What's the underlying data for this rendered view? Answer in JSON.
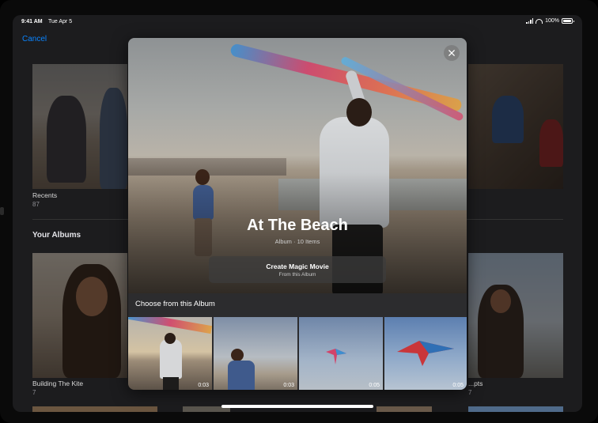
{
  "status_bar": {
    "time": "9:41 AM",
    "date": "Tue Apr 5",
    "battery": "100%"
  },
  "nav": {
    "cancel_label": "Cancel"
  },
  "recents": {
    "label": "Recents",
    "count": "87"
  },
  "your_albums": {
    "title": "Your Albums",
    "items": [
      {
        "label": "Building The Kite",
        "count": "7"
      },
      {
        "label": "...pts",
        "count": "7"
      }
    ]
  },
  "modal": {
    "album_title": "At The Beach",
    "album_subtitle": "Album · 10 Items",
    "magic_movie": {
      "title": "Create Magic Movie",
      "subtitle": "From this Album"
    },
    "choose_label": "Choose from this Album",
    "thumbnails": [
      {
        "duration": "0:03"
      },
      {
        "duration": "0:03"
      },
      {
        "duration": "0:05"
      },
      {
        "duration": "0:05"
      }
    ]
  },
  "colors": {
    "accent": "#0a84ff",
    "background": "#1c1c1e",
    "modal": "#2c2c2e"
  }
}
